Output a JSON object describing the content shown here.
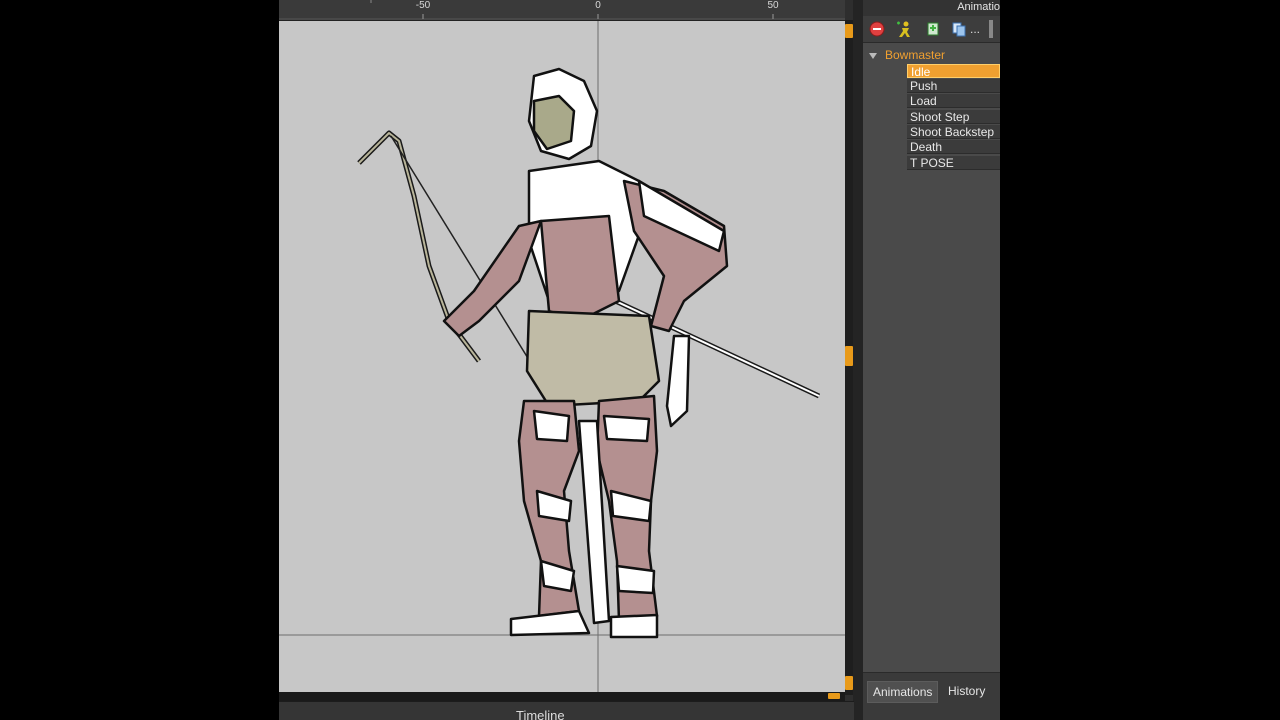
{
  "ruler": {
    "ticks": [
      "-50",
      "0",
      "50"
    ]
  },
  "panel": {
    "title": "Animatio",
    "tree_root": "Bowmaster",
    "animations": [
      "Idle",
      "Push",
      "Load",
      "Shoot Step",
      "Shoot Backstep",
      "Death",
      "T POSE"
    ],
    "selected_animation": "Idle",
    "tabs": [
      "Animations",
      "History"
    ],
    "toolbar": [
      {
        "icon": "remove-icon",
        "color": "#e04040"
      },
      {
        "icon": "new-animation-icon",
        "color": "#d8c020"
      },
      {
        "icon": "add-animation-icon",
        "color": "#40b040"
      },
      {
        "icon": "duplicate-icon",
        "color": "#3a88d8"
      },
      {
        "icon": "more-icon",
        "label": "..."
      }
    ]
  },
  "timeline": {
    "label": "Timeline"
  },
  "colors": {
    "accent": "#f0a030",
    "canvas": "#c7c7c7",
    "panel": "#4a4a4a"
  }
}
